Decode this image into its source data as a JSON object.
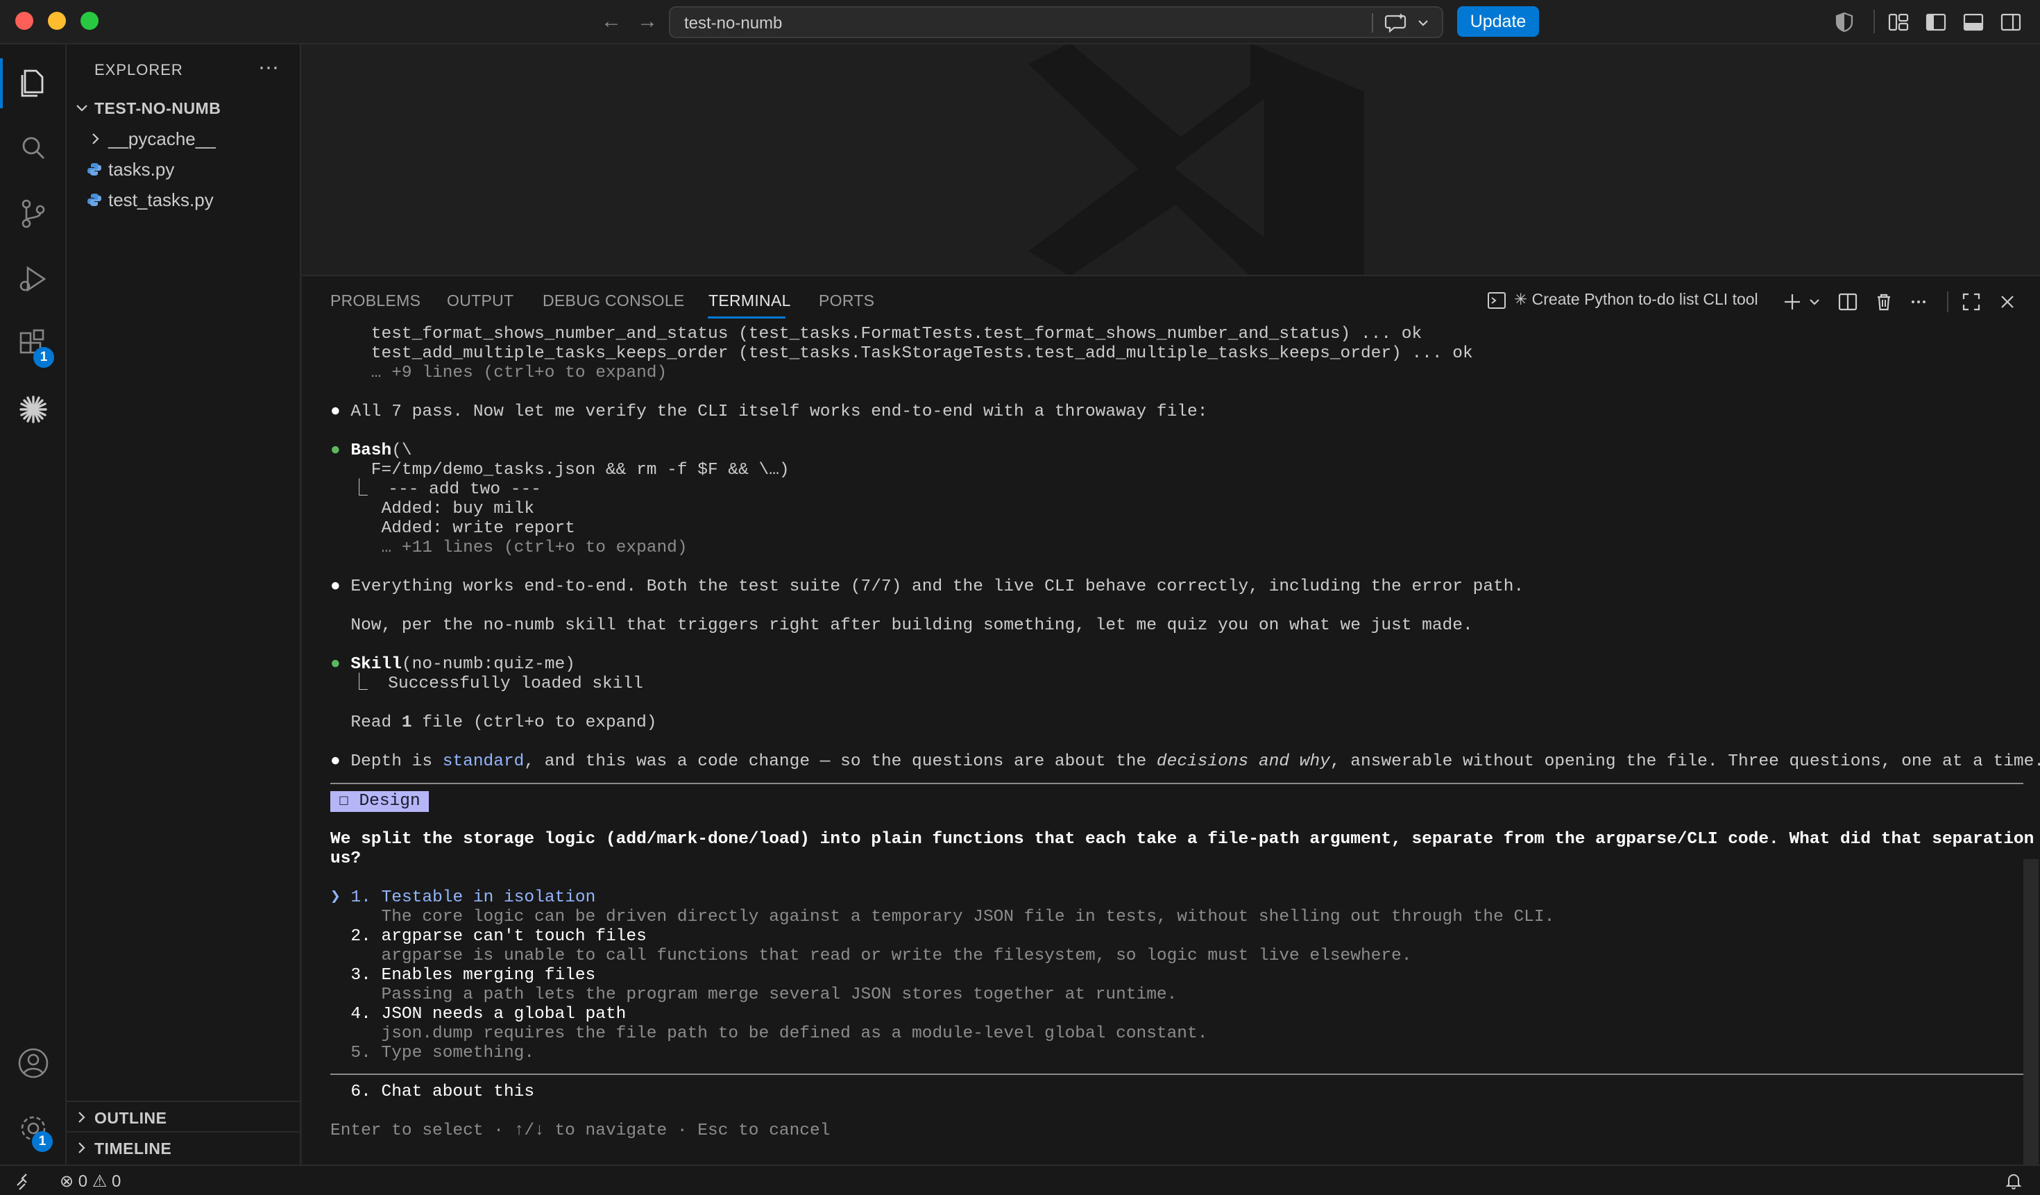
{
  "titlebar": {
    "search_text": "test-no-numb",
    "update_label": "Update"
  },
  "activity": {
    "extensions_badge": "1",
    "settings_badge": "1"
  },
  "sidebar": {
    "title": "EXPLORER",
    "more": "···",
    "root_folder": "TEST-NO-NUMB",
    "items": [
      {
        "label": "__pycache__",
        "type": "folder"
      },
      {
        "label": "tasks.py",
        "type": "python"
      },
      {
        "label": "test_tasks.py",
        "type": "python"
      }
    ],
    "outline": "OUTLINE",
    "timeline": "TIMELINE"
  },
  "panel": {
    "tabs": [
      "PROBLEMS",
      "OUTPUT",
      "DEBUG CONSOLE",
      "TERMINAL",
      "PORTS"
    ],
    "active_tab": "TERMINAL",
    "terminal_title": "✳ Create Python to-do list CLI tool"
  },
  "terminal": {
    "l1": "    test_format_shows_number_and_status (test_tasks.FormatTests.test_format_shows_number_and_status) ... ok",
    "l2": "    test_add_multiple_tasks_keeps_order (test_tasks.TaskStorageTests.test_add_multiple_tasks_keeps_order) ... ok",
    "l3": "    … +9 lines (ctrl+o to expand)",
    "l4": " All 7 pass. Now let me verify the CLI itself works end-to-end with a throwaway file:",
    "bash_head": "Bash",
    "bash_paren": "(\\",
    "l6": "    F=/tmp/demo_tasks.json && rm -f $F && \\…)",
    "l7": "  ⎿  --- add two ---",
    "l8": "     Added: buy milk",
    "l9": "     Added: write report",
    "l10": "     … +11 lines (ctrl+o to expand)",
    "l11": " Everything works end-to-end. Both the test suite (7/7) and the live CLI behave correctly, including the error path.",
    "l12": "  Now, per the no-numb skill that triggers right after building something, let me quiz you on what we just made.",
    "skill_head": "Skill",
    "skill_paren": "(no-numb:quiz-me)",
    "l14": "  ⎿  Successfully loaded skill",
    "l15a": "  Read ",
    "l15b": "1",
    "l15c": " file (ctrl+o to expand)",
    "l16a": " Depth is ",
    "l16b": "standard",
    "l16c": ", and this was a code change — so the questions are about the ",
    "l16d": "decisions and why",
    "l16e": ", answerable without opening the file. Three questions, one at a time.",
    "design_badge": "☐ Design",
    "q1": "We split the storage logic (add/mark-done/load) into plain functions that each take a file-path argument, separate from the argparse/CLI code. What did that separation buy",
    "q2": "us?",
    "pointer": "❯",
    "opt1_num": " 1. ",
    "opt1_title": "Testable in isolation",
    "opt1_desc": "     The core logic can be driven directly against a temporary JSON file in tests, without shelling out through the CLI.",
    "opt2_title": "  2. argparse can't touch files",
    "opt2_desc": "     argparse is unable to call functions that read or write the filesystem, so logic must live elsewhere.",
    "opt3_title": "  3. Enables merging files",
    "opt3_desc": "     Passing a path lets the program merge several JSON stores together at runtime.",
    "opt4_title": "  4. JSON needs a global path",
    "opt4_desc": "     json.dump requires the file path to be defined as a module-level global constant.",
    "opt5": "  5. Type something.",
    "opt6": "  6. Chat about this",
    "footer": "Enter to select · ↑/↓ to navigate · Esc to cancel"
  },
  "statusbar": {
    "errors": "0",
    "warnings": "0"
  }
}
